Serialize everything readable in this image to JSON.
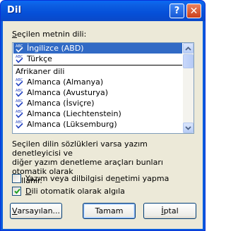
{
  "window": {
    "title": "Dil",
    "help_glyph": "?",
    "close_glyph": "✕"
  },
  "language_list": {
    "label_accel": "S",
    "label_rest": "eçilen metnin dili:",
    "selected_index": 0,
    "items": [
      {
        "label": "İngilizce (ABD)",
        "spell_icon": true
      },
      {
        "label": "Türkçe",
        "spell_icon": true
      },
      {
        "label": "Afrikaner dili",
        "spell_icon": false
      },
      {
        "label": "Almanca (Almanya)",
        "spell_icon": true
      },
      {
        "label": "Almanca (Avusturya)",
        "spell_icon": true
      },
      {
        "label": "Almanca (İsviçre)",
        "spell_icon": true
      },
      {
        "label": "Almanca (Liechtenstein)",
        "spell_icon": true
      },
      {
        "label": "Almanca (Lüksemburg)",
        "spell_icon": true
      }
    ]
  },
  "description": {
    "line1": "Seçilen dilin sözlükleri varsa yazım denetleyicisi ve",
    "line2": "diğer yazım denetleme araçları bunları otomatik olarak",
    "line3": "kullanır."
  },
  "options": {
    "no_spellcheck": {
      "pre": "Yazım veya dilbilgisi de",
      "accel": "n",
      "post": "etimi yapma",
      "checked": false
    },
    "auto_detect": {
      "pre": "",
      "accel": "D",
      "post": "ili otomatik olarak algıla",
      "checked": true
    }
  },
  "buttons": {
    "defaults": {
      "accel": "V",
      "rest": "arsayılan..."
    },
    "ok": "Tamam",
    "cancel": {
      "accel": "İ",
      "rest": "ptal"
    }
  },
  "colors": {
    "selection": "#316ac5",
    "titlebar": "#0550d8",
    "dialog_face": "#ece9d8",
    "spell_icon_blue": "#1f3fbf"
  }
}
